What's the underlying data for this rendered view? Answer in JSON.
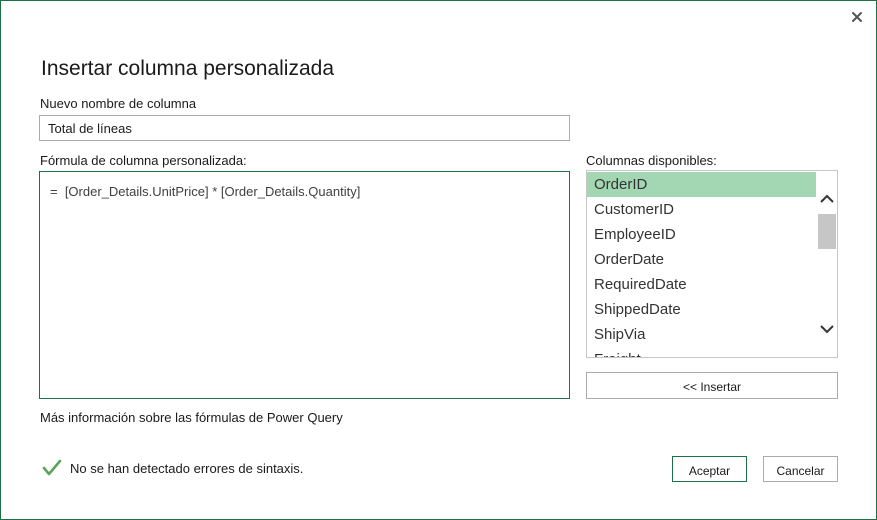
{
  "dialog": {
    "title": "Insertar columna personalizada",
    "close_icon": "close-icon"
  },
  "name_field": {
    "label": "Nuevo nombre de columna",
    "value": "Total de líneas"
  },
  "formula": {
    "label": "Fórmula de columna personalizada:",
    "text": "=  [Order_Details.UnitPrice] * [Order_Details.Quantity]"
  },
  "available_columns": {
    "label": "Columnas disponibles:",
    "items": [
      "OrderID",
      "CustomerID",
      "EmployeeID",
      "OrderDate",
      "RequiredDate",
      "ShippedDate",
      "ShipVia",
      "Freight"
    ],
    "selected": "OrderID",
    "insert_label": "<< Insertar"
  },
  "help_link": "Más información sobre las fórmulas de Power Query",
  "status": {
    "icon": "checkmark-icon",
    "text": "No se han detectado errores de sintaxis."
  },
  "buttons": {
    "ok": "Aceptar",
    "cancel": "Cancelar"
  },
  "colors": {
    "accent": "#1e7145",
    "selection": "#a3d6b3",
    "check": "#5ba55b"
  }
}
